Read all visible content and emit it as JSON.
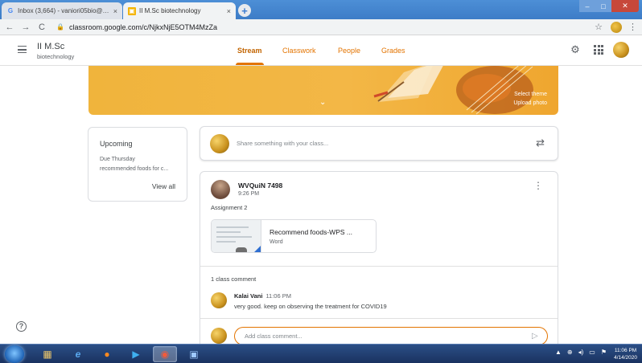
{
  "browser": {
    "tabs": [
      {
        "title": "Inbox (3,664) - vaniori05bio@gm",
        "icon": "gmail-icon",
        "active": false
      },
      {
        "title": "II M.Sc biotechnology",
        "icon": "classroom-icon",
        "active": true
      }
    ],
    "close_glyph": "×",
    "new_tab_glyph": "+",
    "url": "classroom.google.com/c/NjkxNjE5OTM4MzZa",
    "back": "←",
    "forward": "→",
    "reload": "C",
    "star": "☆",
    "menu": "⋮",
    "window_controls": {
      "minimize": "–",
      "maximize": "□",
      "close": "✕"
    }
  },
  "header": {
    "class_name": "II M.Sc",
    "class_section": "biotechnology",
    "tabs": [
      {
        "label": "Stream",
        "active": true
      },
      {
        "label": "Classwork",
        "active": false
      },
      {
        "label": "People",
        "active": false
      },
      {
        "label": "Grades",
        "active": false
      }
    ],
    "settings_glyph": "⚙"
  },
  "banner": {
    "expand_glyph": "⌄",
    "select_theme": "Select theme",
    "upload_photo": "Upload photo",
    "colors": {
      "primary": "#f0b43c",
      "accent": "#e37400"
    }
  },
  "upcoming": {
    "title": "Upcoming",
    "due": "Due Thursday",
    "item": "recommended foods for c...",
    "view_all": "View all"
  },
  "share": {
    "placeholder": "Share something with your class...",
    "repost_glyph": "⇄"
  },
  "post": {
    "author": "WVQuiN 7498",
    "time": "9:26 PM",
    "menu_glyph": "⋮",
    "text": "Assignment 2",
    "attachment": {
      "title": "Recommend foods-WPS ...",
      "type": "Word"
    },
    "comment_count": "1 class comment",
    "comment": {
      "author": "Kalai Vani",
      "time": "11:06 PM",
      "text": "very good. keep on observing the treatment for COVID19"
    },
    "add_comment_placeholder": "Add class comment...",
    "send_glyph": "▷"
  },
  "help_glyph": "?",
  "taskbar": {
    "apps": [
      "explorer-icon",
      "ie-icon",
      "firefox-icon",
      "media-icon",
      "chrome-icon",
      "paint-icon"
    ],
    "tray": [
      "▲",
      "⊕",
      "◂)",
      "▭",
      "⚑"
    ],
    "time": "11:06 PM",
    "date": "4/14/2020"
  }
}
